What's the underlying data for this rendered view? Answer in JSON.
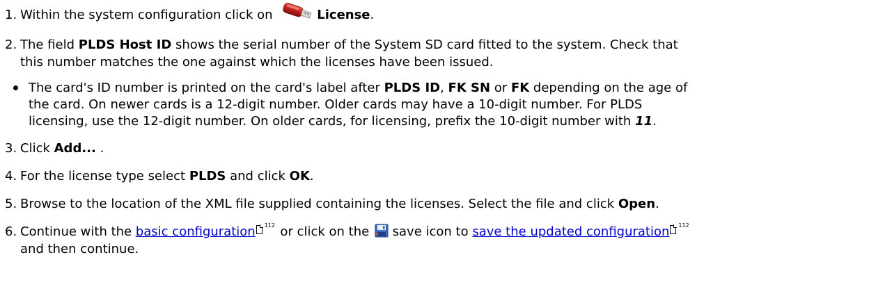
{
  "steps": [
    {
      "num": "1.",
      "before": "Within the system configuration click on ",
      "bold": "License",
      "after": "."
    },
    {
      "num": "2.",
      "lines": [
        {
          "a": "The field ",
          "b": "PLDS Host ID",
          "c": " shows the serial number of the System SD card fitted to the system. Check that"
        },
        {
          "a": "this number matches the one against which the licenses have been issued."
        }
      ]
    },
    {
      "num": "3.",
      "a": "Click ",
      "b": "Add...",
      "c": " ."
    },
    {
      "num": "4.",
      "a": "For the license type select ",
      "b": "PLDS",
      "c": " and click ",
      "d": "OK",
      "e": "."
    },
    {
      "num": "5.",
      "a": "Browse to the location of the XML file supplied containing the licenses. Select the file and click ",
      "b": "Open",
      "c": "."
    },
    {
      "num": "6.",
      "a": "Continue with the ",
      "link1": "basic configuration",
      "c": " or click on the ",
      "d": " save icon to ",
      "link2": "save the updated configuration",
      "e": "and then continue."
    }
  ],
  "bullet": {
    "l1a": "The card's ID number is printed on the card's label after ",
    "l1b": "PLDS ID",
    "l1c": ", ",
    "l1d": "FK SN",
    "l1e": " or ",
    "l1f": "FK",
    "l1g": " depending on the age of",
    "l2": "the card. On newer cards is a 12-digit number. Older cards may have a 10-digit number. For PLDS",
    "l3a": "licensing, use the 12-digit number. On older cards, for licensing, prefix the 10-digit number with ",
    "l3b": "11",
    "l3c": "."
  },
  "page_refs": {
    "ref1": "112",
    "ref2": "112"
  },
  "icons": {
    "license": "usb-key-icon",
    "save": "floppy-disk-save-icon"
  },
  "colors": {
    "link": "#0000c8",
    "usb_red": "#c0201c",
    "save_blue": "#3d6fc4"
  }
}
